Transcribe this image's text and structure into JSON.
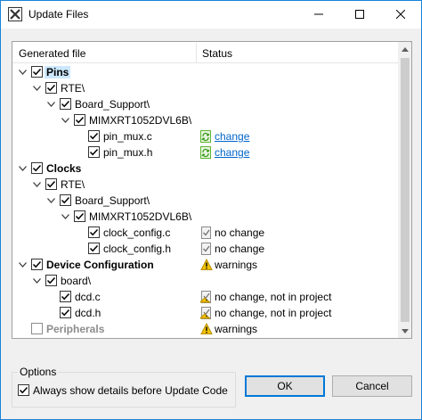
{
  "window": {
    "title": "Update Files",
    "icon": "app-x-icon"
  },
  "columns": {
    "file": "Generated file",
    "status": "Status"
  },
  "tree": [
    {
      "depth": 0,
      "label": "Pins",
      "expanded": true,
      "checked": true,
      "bold": true,
      "selected": true,
      "status": "",
      "status_icon": ""
    },
    {
      "depth": 1,
      "label": "RTE\\",
      "expanded": true,
      "checked": true,
      "status": "",
      "status_icon": ""
    },
    {
      "depth": 2,
      "label": "Board_Support\\",
      "expanded": true,
      "checked": true,
      "status": "",
      "status_icon": ""
    },
    {
      "depth": 3,
      "label": "MIMXRT1052DVL6B\\",
      "expanded": true,
      "checked": true,
      "status": "",
      "status_icon": ""
    },
    {
      "depth": 4,
      "label": "pin_mux.c",
      "leaf": true,
      "checked": true,
      "status": "change",
      "status_icon": "change-icon",
      "link": true
    },
    {
      "depth": 4,
      "label": "pin_mux.h",
      "leaf": true,
      "checked": true,
      "status": "change",
      "status_icon": "change-icon",
      "link": true
    },
    {
      "depth": 0,
      "label": "Clocks",
      "expanded": true,
      "checked": true,
      "bold": true,
      "status": "",
      "status_icon": ""
    },
    {
      "depth": 1,
      "label": "RTE\\",
      "expanded": true,
      "checked": true,
      "status": "",
      "status_icon": ""
    },
    {
      "depth": 2,
      "label": "Board_Support\\",
      "expanded": true,
      "checked": true,
      "status": "",
      "status_icon": ""
    },
    {
      "depth": 3,
      "label": "MIMXRT1052DVL6B\\",
      "expanded": true,
      "checked": true,
      "status": "",
      "status_icon": ""
    },
    {
      "depth": 4,
      "label": "clock_config.c",
      "leaf": true,
      "checked": true,
      "status": "no change",
      "status_icon": "no-change-icon"
    },
    {
      "depth": 4,
      "label": "clock_config.h",
      "leaf": true,
      "checked": true,
      "status": "no change",
      "status_icon": "no-change-icon"
    },
    {
      "depth": 0,
      "label": "Device Configuration",
      "expanded": true,
      "checked": true,
      "bold": true,
      "status": "warnings",
      "status_icon": "warning-icon"
    },
    {
      "depth": 1,
      "label": "board\\",
      "expanded": true,
      "checked": true,
      "status": "",
      "status_icon": ""
    },
    {
      "depth": 2,
      "label": "dcd.c",
      "leaf": true,
      "checked": true,
      "status": "no change, not in project",
      "status_icon": "not-in-project-icon"
    },
    {
      "depth": 2,
      "label": "dcd.h",
      "leaf": true,
      "checked": true,
      "status": "no change, not in project",
      "status_icon": "not-in-project-icon"
    },
    {
      "depth": 0,
      "label": "Peripherals",
      "leaf": true,
      "checked": false,
      "disabled": true,
      "status": "warnings",
      "status_icon": "warning-icon"
    }
  ],
  "options": {
    "title": "Options",
    "always_show_label": "Always show details before Update Code",
    "always_show_checked": true
  },
  "buttons": {
    "ok": "OK",
    "cancel": "Cancel"
  },
  "colors": {
    "accent": "#0078d7",
    "link": "#0066cc",
    "selection": "#cce8ff",
    "change_icon": "#5cb531",
    "warning_icon": "#f2c200"
  }
}
